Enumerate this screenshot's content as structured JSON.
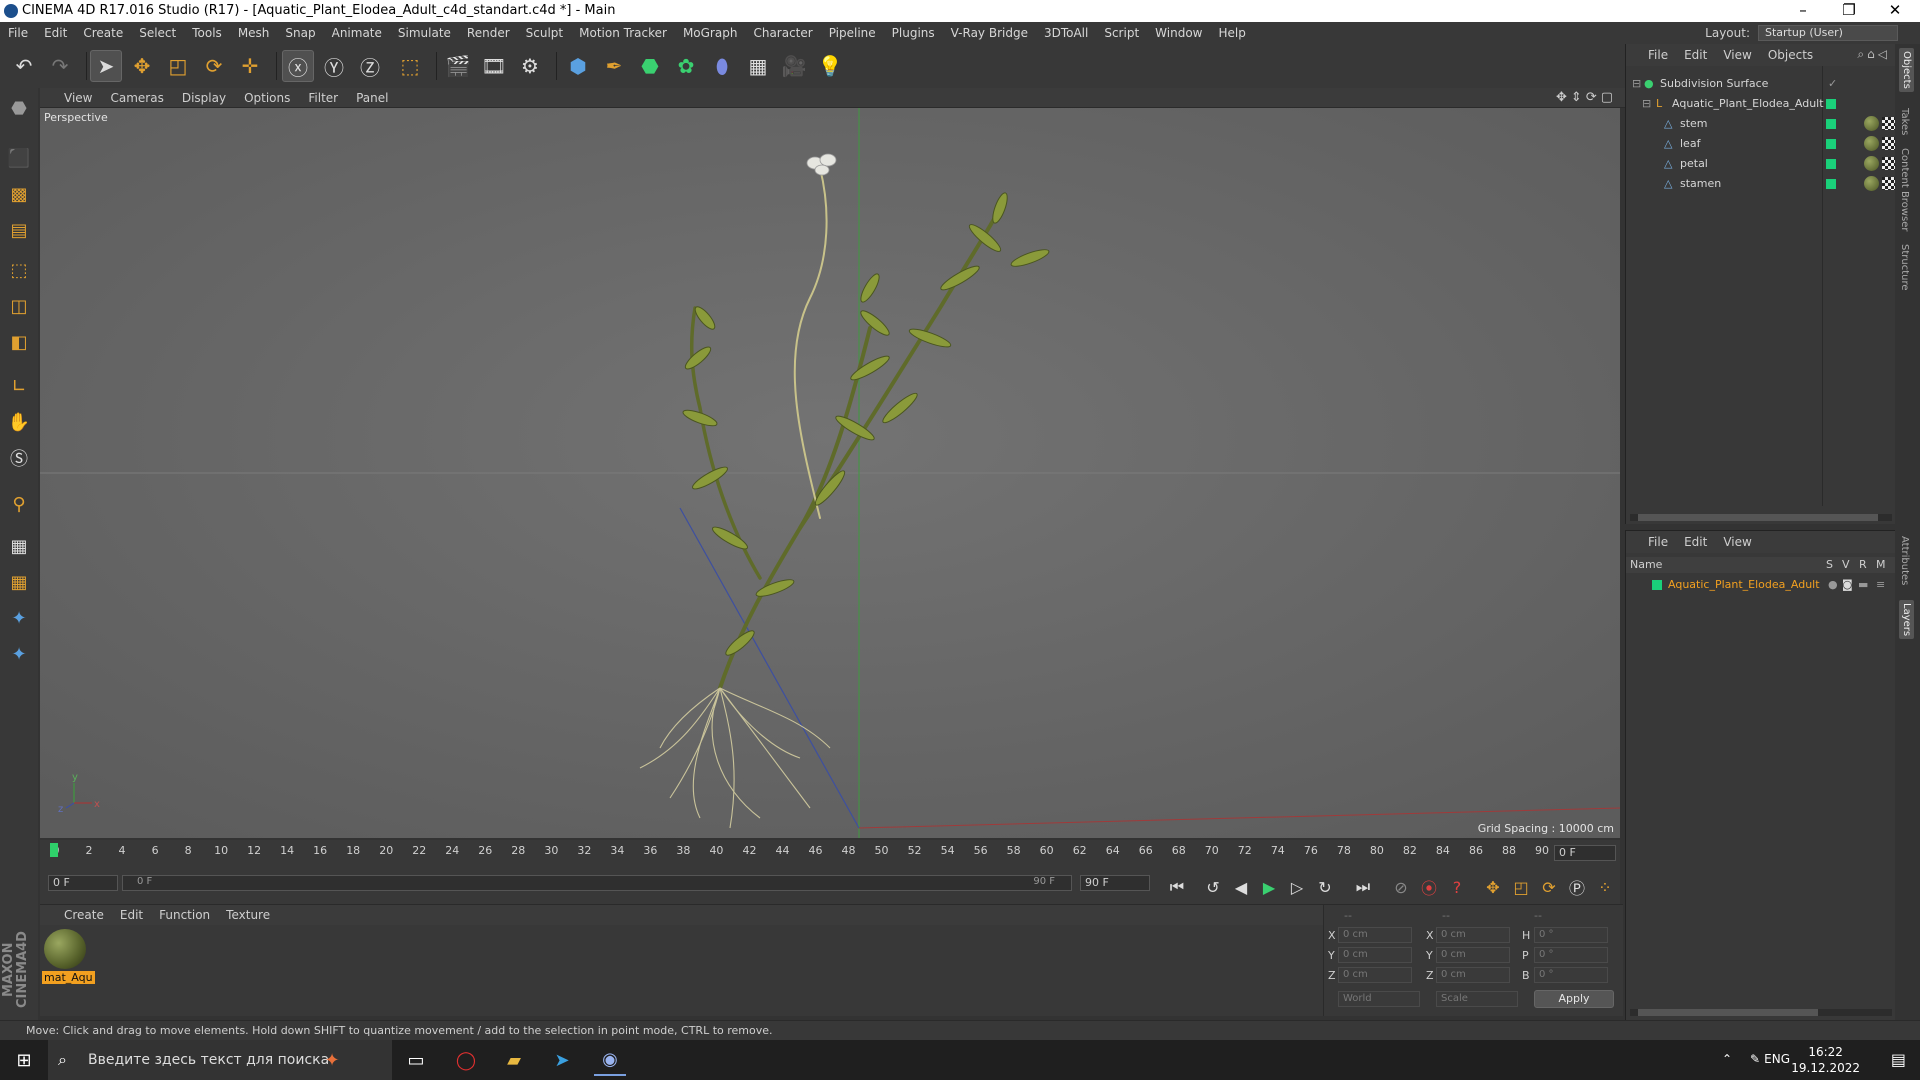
{
  "window": {
    "title": "CINEMA 4D R17.016 Studio (R17) - [Aquatic_Plant_Elodea_Adult_c4d_standart.c4d *] - Main"
  },
  "menubar": {
    "items": [
      "File",
      "Edit",
      "Create",
      "Select",
      "Tools",
      "Mesh",
      "Snap",
      "Animate",
      "Simulate",
      "Render",
      "Sculpt",
      "Motion Tracker",
      "MoGraph",
      "Character",
      "Pipeline",
      "Plugins",
      "V-Ray Bridge",
      "3DToAll",
      "Script",
      "Window",
      "Help"
    ],
    "layout_label": "Layout:",
    "layout_value": "Startup (User)"
  },
  "viewport": {
    "menu": [
      "View",
      "Cameras",
      "Display",
      "Options",
      "Filter",
      "Panel"
    ],
    "camera_label": "Perspective",
    "grid_spacing": "Grid Spacing : 10000 cm"
  },
  "timeline": {
    "ticks": [
      "0",
      "2",
      "4",
      "6",
      "8",
      "10",
      "12",
      "14",
      "16",
      "18",
      "20",
      "22",
      "24",
      "26",
      "28",
      "30",
      "32",
      "34",
      "36",
      "38",
      "40",
      "42",
      "44",
      "46",
      "48",
      "50",
      "52",
      "54",
      "56",
      "58",
      "60",
      "62",
      "64",
      "66",
      "68",
      "70",
      "72",
      "74",
      "76",
      "78",
      "80",
      "82",
      "84",
      "86",
      "88",
      "90"
    ],
    "current_frame": "0 F"
  },
  "transport": {
    "start_field": "0 F",
    "range_start": "0 F",
    "range_end": "90 F",
    "end_field": "90 F"
  },
  "material_manager": {
    "menu": [
      "Create",
      "Edit",
      "Function",
      "Texture"
    ],
    "materials": [
      {
        "name": "mat_Aqu"
      }
    ]
  },
  "coordinates": {
    "header": [
      "--",
      "--",
      "--"
    ],
    "rows": [
      {
        "axis": "X",
        "pos": "0 cm",
        "axis2": "X",
        "size": "0 cm",
        "axis3": "H",
        "rot": "0 °"
      },
      {
        "axis": "Y",
        "pos": "0 cm",
        "axis2": "Y",
        "size": "0 cm",
        "axis3": "P",
        "rot": "0 °"
      },
      {
        "axis": "Z",
        "pos": "0 cm",
        "axis2": "Z",
        "size": "0 cm",
        "axis3": "B",
        "rot": "0 °"
      }
    ],
    "mode_world": "World",
    "mode_scale": "Scale",
    "apply": "Apply"
  },
  "object_manager": {
    "menu": [
      "File",
      "Edit",
      "View",
      "Objects"
    ],
    "objects": [
      {
        "name": "Subdivision Surface",
        "level": 0
      },
      {
        "name": "Aquatic_Plant_Elodea_Adult",
        "level": 1
      },
      {
        "name": "stem",
        "level": 2
      },
      {
        "name": "leaf",
        "level": 2
      },
      {
        "name": "petal",
        "level": 2
      },
      {
        "name": "stamen",
        "level": 2
      }
    ]
  },
  "layer_manager": {
    "menu": [
      "File",
      "Edit",
      "View"
    ],
    "columns": [
      "Name",
      "S",
      "V",
      "R",
      "M"
    ],
    "layers": [
      {
        "name": "Aquatic_Plant_Elodea_Adult",
        "color": "#f2a020"
      }
    ]
  },
  "right_tabs": [
    "Objects",
    "Takes",
    "Content Browser",
    "Structure",
    "Attributes",
    "Layers"
  ],
  "status": {
    "text": "Move: Click and drag to move elements. Hold down SHIFT to quantize movement / add to the selection in point mode, CTRL to remove."
  },
  "taskbar": {
    "search_placeholder": "Введите здесь текст для поиска",
    "lang": "ENG",
    "time": "16:22",
    "date": "19.12.2022"
  },
  "colors": {
    "accent": "#f2a020",
    "object_green": "#1ad07a",
    "viewport_bg": "#6a6a6a",
    "panel_bg": "#383838"
  }
}
